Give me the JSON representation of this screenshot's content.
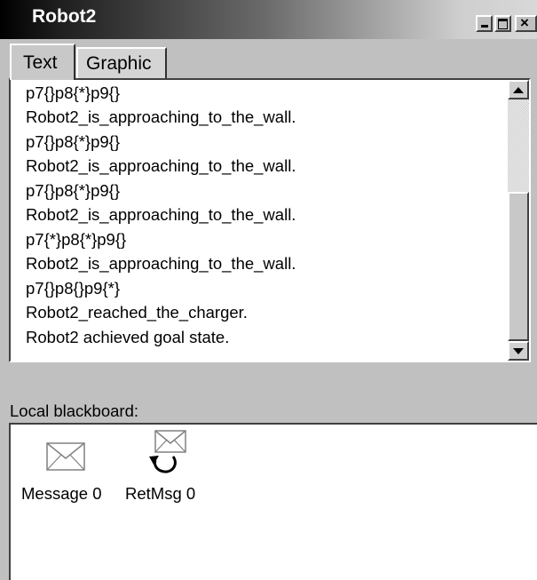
{
  "window": {
    "title": "Robot2"
  },
  "titlebar_buttons": {
    "minimize_icon": "minimize-icon",
    "maximize_icon": "maximize-icon",
    "close_icon": "close-icon"
  },
  "tabs": [
    {
      "label": "Text",
      "active": true
    },
    {
      "label": "Graphic",
      "active": false
    }
  ],
  "log": {
    "lines": [
      "p7{}p8{*}p9{}",
      "Robot2_is_approaching_to_the_wall.",
      "p7{}p8{*}p9{}",
      "Robot2_is_approaching_to_the_wall.",
      "p7{}p8{*}p9{}",
      "Robot2_is_approaching_to_the_wall.",
      "p7{*}p8{*}p9{}",
      "Robot2_is_approaching_to_the_wall.",
      "p7{}p8{}p9{*}",
      "Robot2_reached_the_charger.",
      "Robot2 achieved goal state."
    ]
  },
  "blackboard": {
    "label": "Local blackboard:",
    "items": [
      {
        "label": "Message 0",
        "icon": "envelope-icon"
      },
      {
        "label": "RetMsg 0",
        "icon": "envelope-return-icon"
      }
    ]
  },
  "colors": {
    "window_bg": "#c0c0c0",
    "panel_bg": "#ffffff",
    "title_text": "#ffffff"
  }
}
